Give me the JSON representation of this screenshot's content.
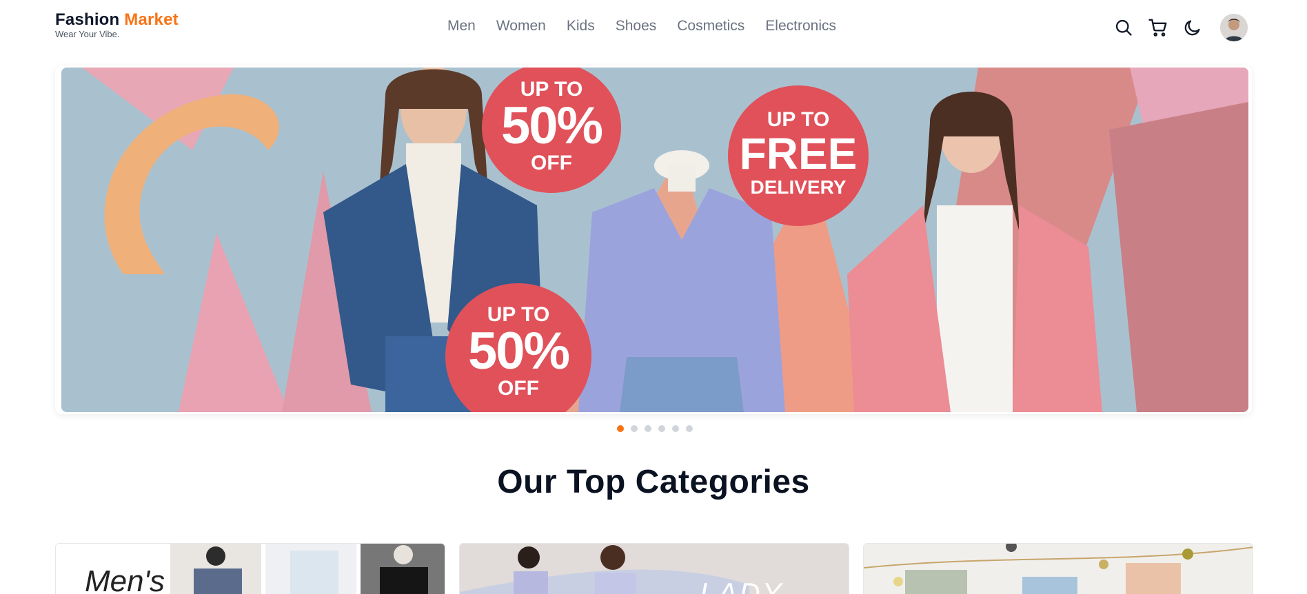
{
  "brand": {
    "name_primary": "Fashion",
    "name_accent": "Market",
    "tagline": "Wear Your Vibe.",
    "accent_color": "#f97316"
  },
  "nav": {
    "items": [
      "Men",
      "Women",
      "Kids",
      "Shoes",
      "Cosmetics",
      "Electronics"
    ]
  },
  "header_icons": [
    "search-icon",
    "cart-icon",
    "moon-icon",
    "avatar"
  ],
  "hero": {
    "badge_1": {
      "l1": "UP TO",
      "l2": "50%",
      "l3": "OFF"
    },
    "badge_2": {
      "l1": "UP TO",
      "l2": "FREE",
      "l3": "DELIVERY"
    },
    "badge_3": {
      "l1": "UP TO",
      "l2": "50%",
      "l3": "OFF"
    },
    "badge_color": "#e0515a",
    "slide_count": 6,
    "active_slide": 1
  },
  "categories": {
    "title": "Our Top Categories",
    "cards": [
      {
        "label": "Men's"
      },
      {
        "label": "LADY"
      },
      {
        "label": ""
      }
    ]
  }
}
